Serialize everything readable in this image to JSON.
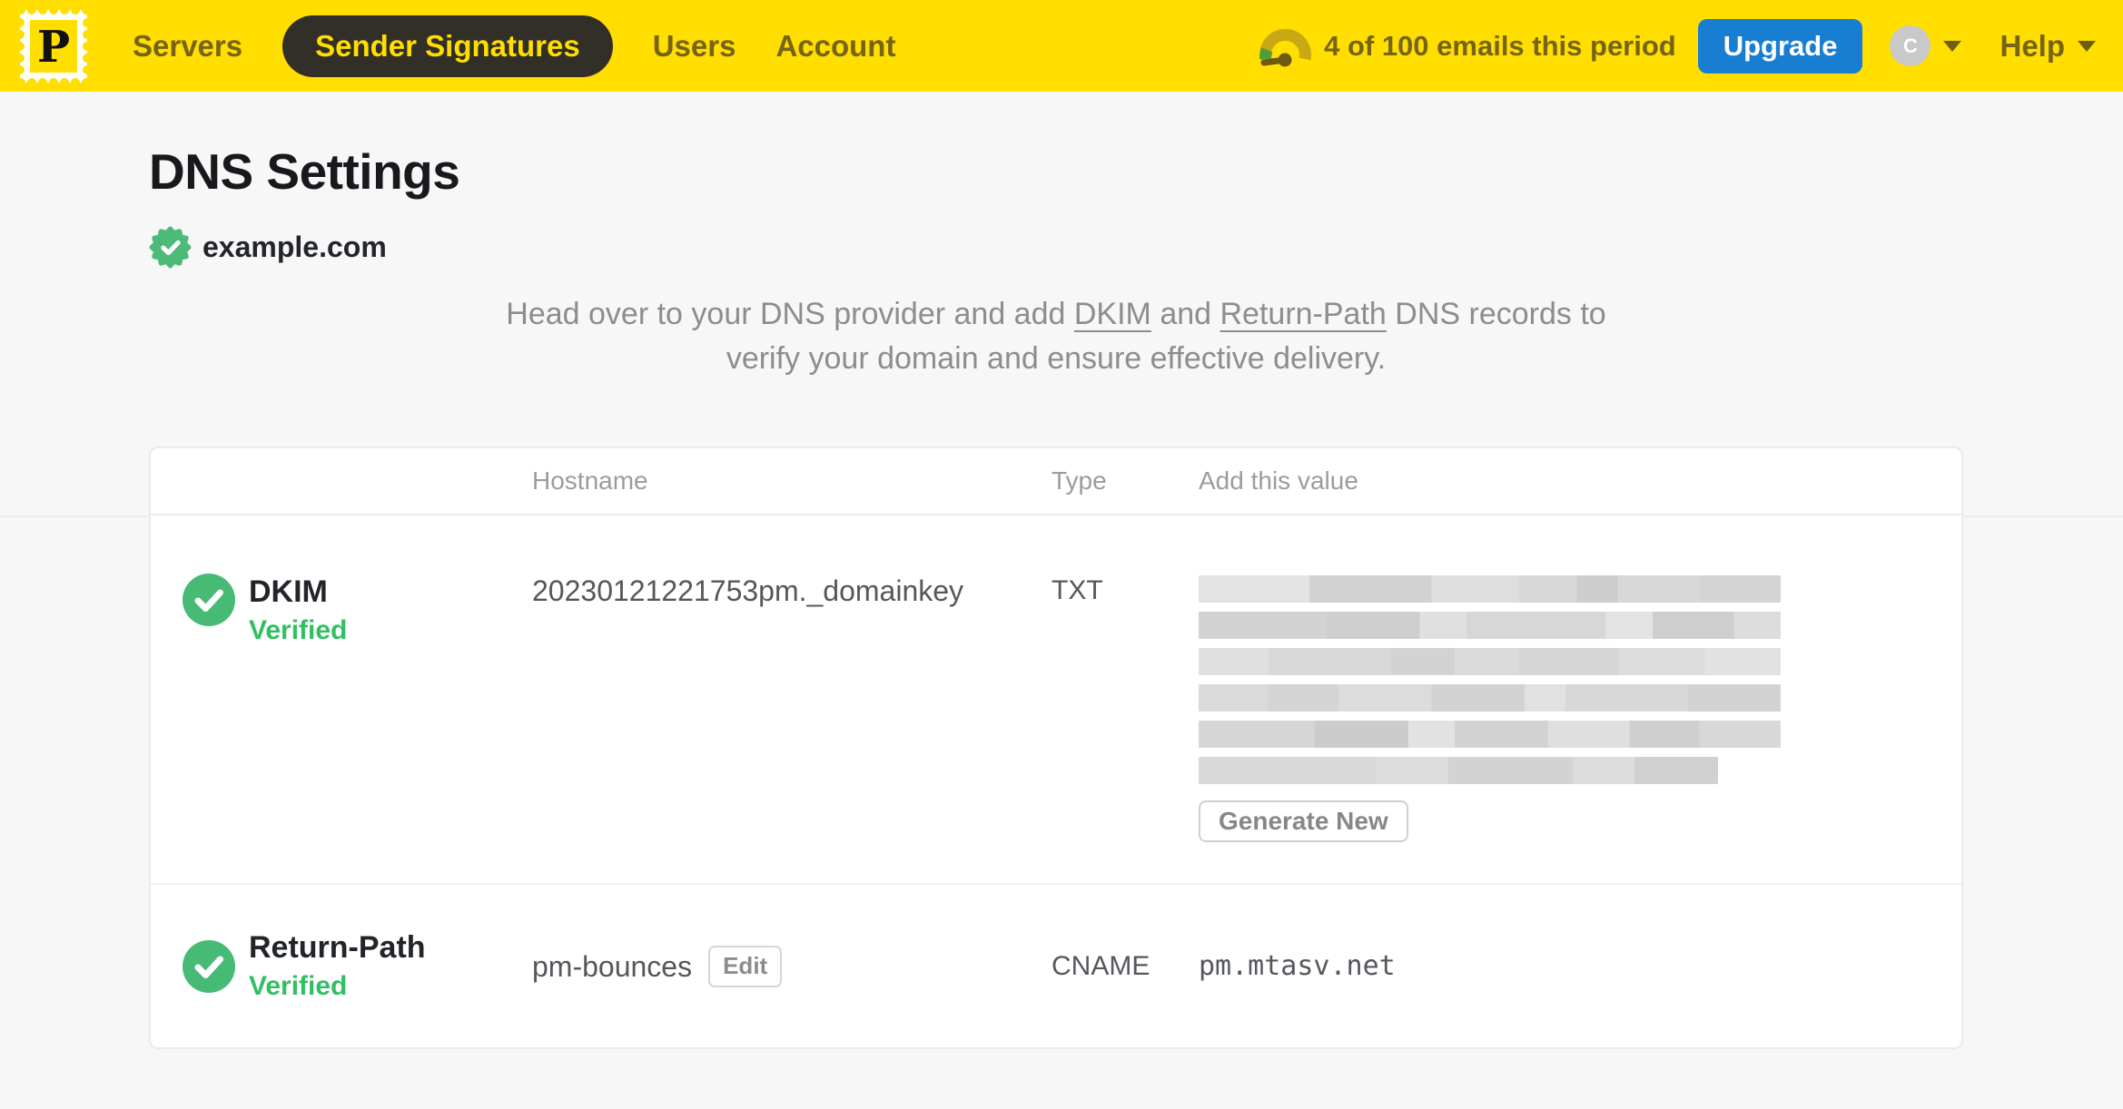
{
  "brand": {
    "logo_letter": "P"
  },
  "nav": {
    "items": [
      {
        "label": "Servers",
        "active": false
      },
      {
        "label": "Sender Signatures",
        "active": true
      },
      {
        "label": "Users",
        "active": false
      },
      {
        "label": "Account",
        "active": false
      }
    ]
  },
  "usage": {
    "text": "4 of 100 emails this period"
  },
  "upgrade_label": "Upgrade",
  "account_menu": {
    "avatar_initial": "C"
  },
  "help_label": "Help",
  "page": {
    "title": "DNS Settings",
    "domain": "example.com",
    "description": {
      "line1_prefix": "Head over to your DNS provider and add ",
      "dkim_link": "DKIM",
      "line1_and": " and ",
      "return_path_link": "Return-Path",
      "line1_suffix": " DNS records to",
      "line2": "verify your domain and ensure effective delivery."
    }
  },
  "table": {
    "headers": {
      "hostname": "Hostname",
      "type": "Type",
      "value": "Add this value"
    },
    "rows": [
      {
        "name": "DKIM",
        "status": "Verified",
        "hostname": "20230121221753pm._domainkey",
        "type": "TXT",
        "value_redacted": true,
        "action_label": "Generate New"
      },
      {
        "name": "Return-Path",
        "status": "Verified",
        "hostname": "pm-bounces",
        "edit_label": "Edit",
        "type": "CNAME",
        "value": "pm.mtasv.net"
      }
    ]
  },
  "colors": {
    "brand_yellow": "#FFDE00",
    "nav_text": "#766314",
    "active_pill_bg": "#322F28",
    "upgrade_blue": "#177ED2",
    "verified_green": "#32BF63",
    "check_circle_green": "#47BA75"
  }
}
